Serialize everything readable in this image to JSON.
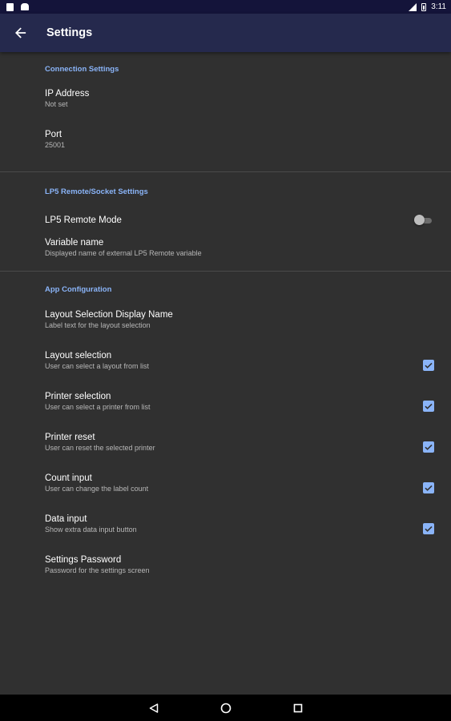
{
  "status_bar": {
    "time": "3:11"
  },
  "app_bar": {
    "title": "Settings"
  },
  "sections": {
    "connection": {
      "header": "Connection Settings",
      "ip_address": {
        "title": "IP Address",
        "summary": "Not set"
      },
      "port": {
        "title": "Port",
        "summary": "25001"
      }
    },
    "lp5": {
      "header": "LP5 Remote/Socket Settings",
      "remote_mode": {
        "title": "LP5 Remote Mode",
        "enabled": false
      },
      "variable_name": {
        "title": "Variable name",
        "summary": "Displayed name of external LP5 Remote variable"
      }
    },
    "app_config": {
      "header": "App Configuration",
      "layout_display_name": {
        "title": "Layout Selection Display Name",
        "summary": "Label text for the layout selection"
      },
      "layout_selection": {
        "title": "Layout selection",
        "summary": "User can select a layout from list",
        "checked": true
      },
      "printer_selection": {
        "title": "Printer selection",
        "summary": "User can select a printer from list",
        "checked": true
      },
      "printer_reset": {
        "title": "Printer reset",
        "summary": "User can reset the selected printer",
        "checked": true
      },
      "count_input": {
        "title": "Count input",
        "summary": "User can change the label count",
        "checked": true
      },
      "data_input": {
        "title": "Data input",
        "summary": "Show extra data input button",
        "checked": true
      },
      "settings_password": {
        "title": "Settings Password",
        "summary": "Password for the settings screen"
      }
    }
  },
  "colors": {
    "accent": "#8ab4f8",
    "app_bar": "#25294d",
    "background": "#303030"
  },
  "icons": {
    "back": "arrow-back-icon",
    "nav_back": "triangle-back-icon",
    "nav_home": "circle-home-icon",
    "nav_recents": "square-recents-icon"
  }
}
